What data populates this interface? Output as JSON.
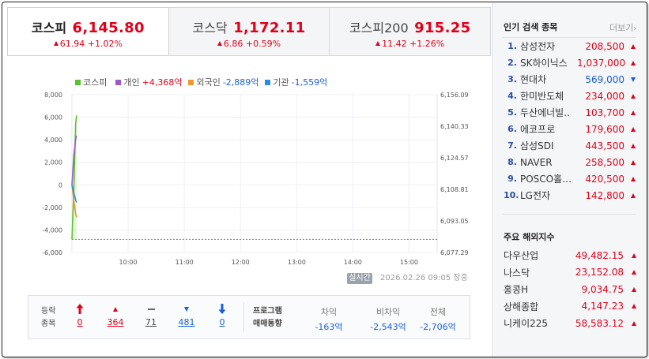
{
  "tabs": [
    {
      "name": "코스피",
      "value": "6,145.80",
      "change": "61.94 +1.02%"
    },
    {
      "name": "코스닥",
      "value": "1,172.11",
      "change": "6.86 +0.59%"
    },
    {
      "name": "코스피200",
      "value": "915.25",
      "change": "11.42 +1.26%"
    }
  ],
  "legend": {
    "kospi": "코스피",
    "individual": "개인",
    "individual_value": "+4,368억",
    "foreign": "외국인",
    "foreign_value": "-2,889억",
    "institution": "기관",
    "institution_value": "-1,559억"
  },
  "colors": {
    "up": "#e0001a",
    "down": "#1a5fd9",
    "kospi": "#5cc22b",
    "individual": "#9b59d0",
    "foreign": "#f0962d",
    "institution": "#2f8be0"
  },
  "chart_data": {
    "type": "line",
    "left_axis": {
      "ticks": [
        "8,000",
        "6,000",
        "4,000",
        "2,000",
        "0",
        "-2,000",
        "-4,000",
        "-6,000"
      ],
      "range": [
        -6000,
        8000
      ]
    },
    "right_axis": {
      "ticks": [
        "6,156.09",
        "6,140.33",
        "6,124.57",
        "6,108.81",
        "6,093.05",
        "6,077.29"
      ],
      "range": [
        6077.29,
        6156.09
      ]
    },
    "x_ticks": [
      "10:00",
      "11:00",
      "12:00",
      "13:00",
      "14:00",
      "15:00"
    ],
    "x_range": [
      "09:00",
      "15:30"
    ],
    "baseline_value": 6083.86,
    "series": [
      {
        "name": "코스피",
        "axis": "right",
        "x": [
          "09:00",
          "09:02",
          "09:04",
          "09:05"
        ],
        "values": [
          6083.86,
          6108.5,
          6142.0,
          6145.8
        ]
      },
      {
        "name": "개인",
        "axis": "left",
        "x": [
          "09:00",
          "09:02",
          "09:04",
          "09:05"
        ],
        "values": [
          0,
          2600,
          4100,
          4368
        ]
      },
      {
        "name": "외국인",
        "axis": "left",
        "x": [
          "09:00",
          "09:02",
          "09:04",
          "09:05"
        ],
        "values": [
          0,
          -1400,
          -2600,
          -2889
        ]
      },
      {
        "name": "기관",
        "axis": "left",
        "x": [
          "09:00",
          "09:02",
          "09:04",
          "09:05"
        ],
        "values": [
          0,
          -700,
          -1350,
          -1559
        ]
      }
    ]
  },
  "realtime_label": "실시간",
  "timestamp": "2026.02.26 09:05 장중",
  "rise_fall": {
    "title_line1": "등락",
    "title_line2": "종목",
    "upper_limit": "0",
    "rise": "364",
    "unchanged": "71",
    "fall": "481",
    "lower_limit": "0"
  },
  "program": {
    "title_line1": "프로그램",
    "title_line2": "매매동향",
    "arbitrage_label": "차익",
    "arbitrage_value": "-163억",
    "non_arbitrage_label": "비차익",
    "non_arbitrage_value": "-2,543억",
    "total_label": "전체",
    "total_value": "-2,706억"
  },
  "popular": {
    "title": "인기 검색 종목",
    "more": "더보기",
    "items": [
      {
        "rank": "1.",
        "name": "삼성전자",
        "price": "208,500",
        "dir": "up"
      },
      {
        "rank": "2.",
        "name": "SK하이닉스",
        "price": "1,037,000",
        "dir": "up"
      },
      {
        "rank": "3.",
        "name": "현대차",
        "price": "569,000",
        "dir": "down"
      },
      {
        "rank": "4.",
        "name": "한미반도체",
        "price": "234,000",
        "dir": "up"
      },
      {
        "rank": "5.",
        "name": "두산에너빌..",
        "price": "103,700",
        "dir": "up"
      },
      {
        "rank": "6.",
        "name": "에코프로",
        "price": "179,600",
        "dir": "up"
      },
      {
        "rank": "7.",
        "name": "삼성SDI",
        "price": "443,500",
        "dir": "up"
      },
      {
        "rank": "8.",
        "name": "NAVER",
        "price": "258,500",
        "dir": "up"
      },
      {
        "rank": "9.",
        "name": "POSCO홀…",
        "price": "420,500",
        "dir": "up"
      },
      {
        "rank": "10.",
        "name": "LG전자",
        "price": "142,800",
        "dir": "up"
      }
    ]
  },
  "overseas": {
    "title": "주요 해외지수",
    "items": [
      {
        "name": "다우산업",
        "value": "49,482.15"
      },
      {
        "name": "나스닥",
        "value": "23,152.08"
      },
      {
        "name": "홍콩H",
        "value": "9,034.75"
      },
      {
        "name": "상해종합",
        "value": "4,147.23"
      },
      {
        "name": "니케이225",
        "value": "58,583.12"
      }
    ]
  }
}
